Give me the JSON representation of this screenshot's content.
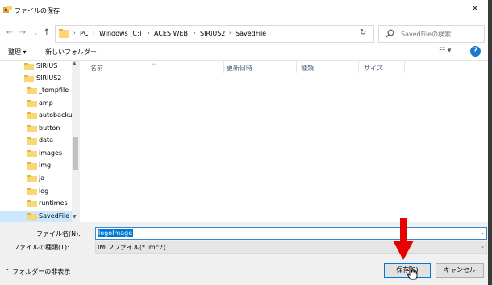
{
  "window": {
    "title": "ファイルの保存",
    "close": "✕"
  },
  "address": {
    "crumbs": [
      "PC",
      "Windows (C:)",
      "ACES WEB",
      "SIRIUS2",
      "SavedFile"
    ],
    "separator": "›"
  },
  "search": {
    "placeholder": "SavedFileの検索"
  },
  "toolbar": {
    "organize": "整理 ▾",
    "new_folder": "新しいフォルダー",
    "view": "☷ ▾",
    "help": "?"
  },
  "nav": {
    "items": [
      {
        "label": "SIRIUS",
        "selected": false
      },
      {
        "label": "SIRIUS2",
        "selected": false
      },
      {
        "label": "_tempfile",
        "selected": false
      },
      {
        "label": "amp",
        "selected": false
      },
      {
        "label": "autobackup",
        "selected": false
      },
      {
        "label": "button",
        "selected": false
      },
      {
        "label": "data",
        "selected": false
      },
      {
        "label": "images",
        "selected": false
      },
      {
        "label": "img",
        "selected": false
      },
      {
        "label": "ja",
        "selected": false
      },
      {
        "label": "log",
        "selected": false
      },
      {
        "label": "runtimes",
        "selected": false
      },
      {
        "label": "SavedFile",
        "selected": true
      }
    ]
  },
  "columns": {
    "name": "名前",
    "modified": "更新日時",
    "type": "種類",
    "size": "サイズ"
  },
  "form": {
    "filename_label": "ファイル名(N):",
    "filename_value": "logoImage",
    "filetype_label": "ファイルの種類(T):",
    "filetype_value": "IMC2ファイル(*.imc2)"
  },
  "footer": {
    "hide_folders": "⌃ フォルダーの非表示",
    "save": "保存(S)",
    "cancel": "キャンセル"
  },
  "colors": {
    "accent": "#0078d7",
    "folder": "#f8d775",
    "arrow": "#e60000",
    "selection": "#cce8ff"
  }
}
